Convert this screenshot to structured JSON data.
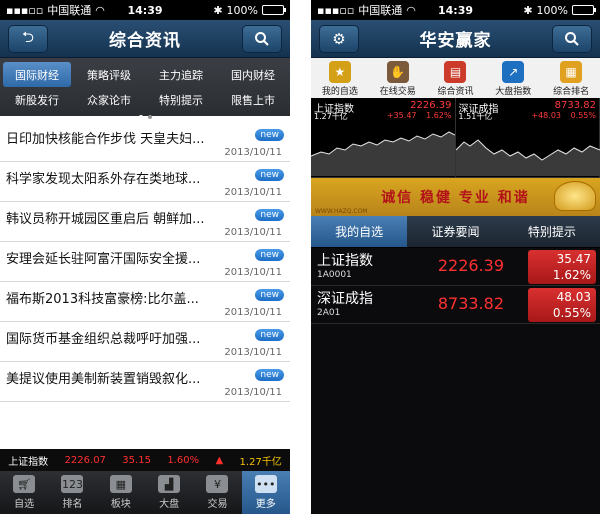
{
  "left": {
    "status": {
      "carrier": "中国联通",
      "time": "14:39",
      "battery": "100%"
    },
    "nav": {
      "title": "综合资讯",
      "back_icon": "back-arrow-icon",
      "search_icon": "search-icon"
    },
    "categories": [
      [
        "国际财经",
        "策略评级",
        "主力追踪",
        "国内财经"
      ],
      [
        "新股发行",
        "众家论市",
        "特别提示",
        "限售上市"
      ]
    ],
    "news": [
      {
        "title": "日印加快核能合作步伐 天皇夫妇...",
        "badge": "new",
        "date": "2013/10/11"
      },
      {
        "title": "科学家发现太阳系外存在类地球...",
        "badge": "new",
        "date": "2013/10/11"
      },
      {
        "title": "韩议员称开城园区重启后 朝鲜加...",
        "badge": "new",
        "date": "2013/10/11"
      },
      {
        "title": "安理会延长驻阿富汗国际安全援...",
        "badge": "new",
        "date": "2013/10/11"
      },
      {
        "title": "福布斯2013科技富豪榜:比尔盖...",
        "badge": "new",
        "date": "2013/10/11"
      },
      {
        "title": "国际货币基金组织总裁呼吁加强...",
        "badge": "new",
        "date": "2013/10/11"
      },
      {
        "title": "美提议使用美制新装置销毁叙化...",
        "badge": "new",
        "date": "2013/10/11"
      }
    ],
    "ticker": {
      "name": "上证指数",
      "price": "2226.07",
      "change": "35.15",
      "percent": "1.60%",
      "volume": "1.27千亿"
    },
    "tabs": [
      {
        "label": "自选",
        "icon": "cart-icon"
      },
      {
        "label": "排名",
        "icon": "ranking-icon"
      },
      {
        "label": "板块",
        "icon": "grid-icon"
      },
      {
        "label": "大盘",
        "icon": "chart-icon"
      },
      {
        "label": "交易",
        "icon": "moneybag-icon"
      },
      {
        "label": "更多",
        "icon": "more-dots-icon"
      }
    ]
  },
  "right": {
    "status": {
      "carrier": "中国联通",
      "time": "14:39",
      "battery": "100%"
    },
    "nav": {
      "title": "华安赢家",
      "settings_icon": "gear-icon",
      "search_icon": "search-icon"
    },
    "icons": [
      {
        "label": "我的自选",
        "icon": "star-folder-icon",
        "color": "#d4a017"
      },
      {
        "label": "在线交易",
        "icon": "trade-hand-icon",
        "color": "#7a5a3a"
      },
      {
        "label": "综合资讯",
        "icon": "news-icon",
        "color": "#cc3b2a"
      },
      {
        "label": "大盘指数",
        "icon": "index-chart-icon",
        "color": "#1f6fc1"
      },
      {
        "label": "综合排名",
        "icon": "ranking-grid-icon",
        "color": "#e0a020"
      }
    ],
    "mini_charts": [
      {
        "name": "上证指数",
        "price": "2226.39",
        "volume": "1.27千亿",
        "change": "+35.47",
        "percent": "1.62%"
      },
      {
        "name": "深证成指",
        "price": "8733.82",
        "volume": "1.51千亿",
        "change": "+48.03",
        "percent": "0.55%"
      }
    ],
    "banner": {
      "text": "诚信 稳健 专业 和谐",
      "site": "WWW.HAZQ.COM"
    },
    "subtabs": [
      "我的自选",
      "证券要闻",
      "特别提示"
    ],
    "quotes": [
      {
        "name": "上证指数",
        "code": "1A0001",
        "price": "2226.39",
        "change": "35.47",
        "percent": "1.62%"
      },
      {
        "name": "深证成指",
        "code": "2A01",
        "price": "8733.82",
        "change": "48.03",
        "percent": "0.55%"
      }
    ]
  },
  "colors": {
    "up_red": "#ff3030",
    "nav_blue": "#1d4469",
    "accent_yellow": "#f5c400"
  }
}
